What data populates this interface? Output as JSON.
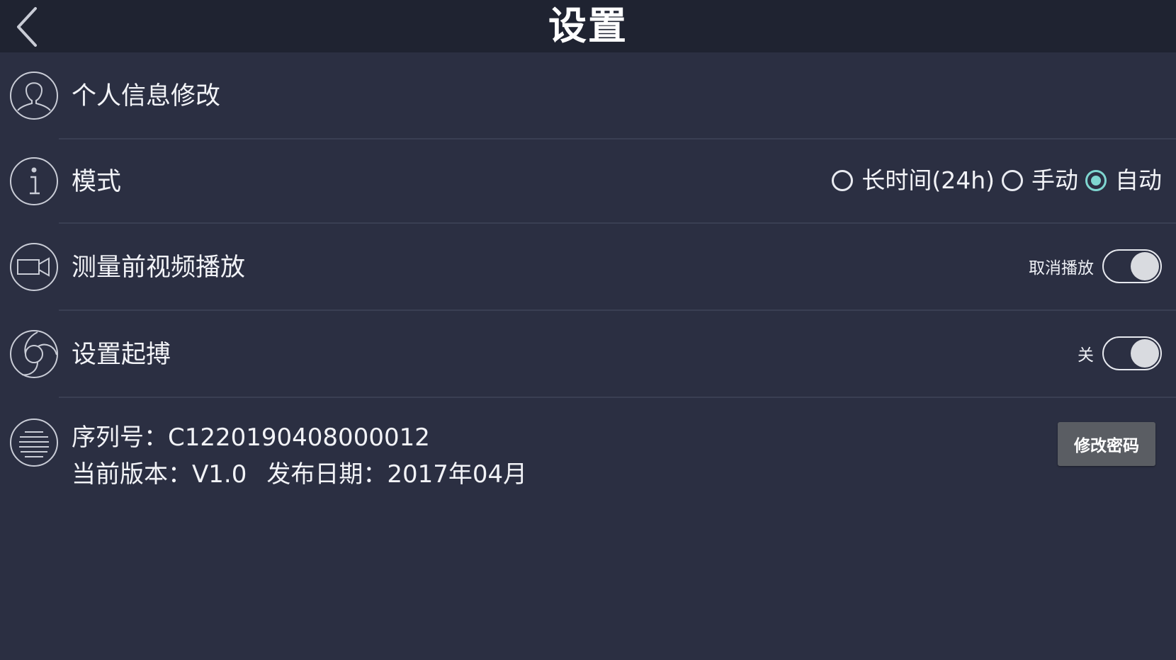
{
  "header": {
    "title": "设置",
    "back_icon": "chevron-left-icon"
  },
  "rows": {
    "profile": {
      "label": "个人信息修改",
      "icon": "user-icon"
    },
    "mode": {
      "label": "模式",
      "icon": "info-icon",
      "options": [
        {
          "label": "长时间(24h)",
          "selected": false
        },
        {
          "label": "手动",
          "selected": false
        },
        {
          "label": "自动",
          "selected": true
        }
      ]
    },
    "video": {
      "label": "测量前视频播放",
      "icon": "video-camera-icon",
      "toggle_text": "取消播放",
      "toggle_on": false
    },
    "start": {
      "label": "设置起搏",
      "icon": "aperture-icon",
      "toggle_text": "关",
      "toggle_on": false
    },
    "info": {
      "icon": "list-icon",
      "serial_label": "序列号：",
      "serial_value": "C1220190408000012",
      "version_label": "当前版本：",
      "version_value": "V1.0",
      "date_label": "发布日期：",
      "date_value": "2017年04月",
      "change_password_button": "修改密码"
    }
  },
  "colors": {
    "background": "#2b2f42",
    "header_bg": "#1f2331",
    "accent": "#7fd6d0",
    "button_bg": "#5a5d63"
  }
}
